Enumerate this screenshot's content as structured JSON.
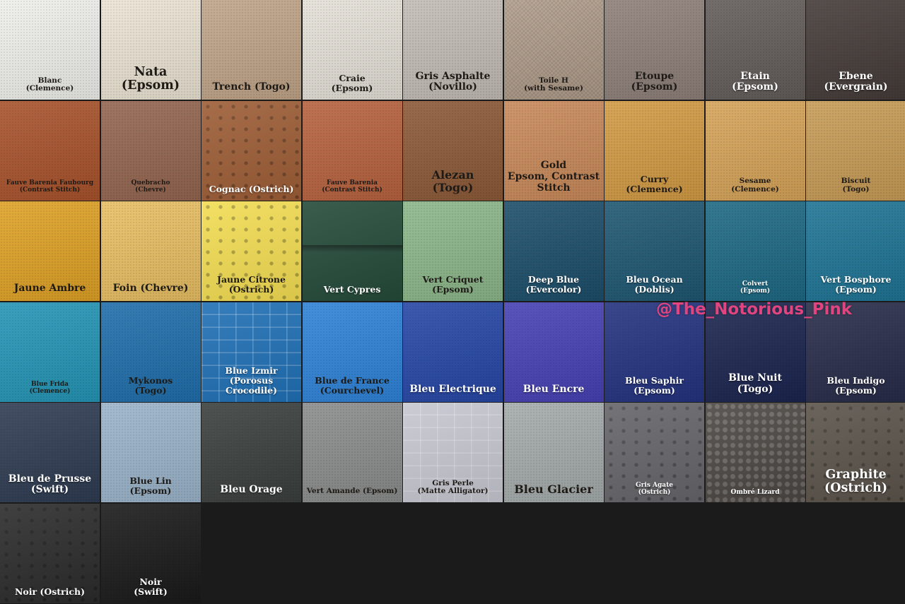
{
  "watermark": "@The_Notorious_Pink",
  "swatches": [
    {
      "name": "Blanc\n(Clemence)",
      "bg": "#efefeb",
      "light": false,
      "size": "s",
      "texture": "grain"
    },
    {
      "name": "Nata\n(Epsom)",
      "bg": "#ebe4d4",
      "light": false,
      "size": "xxl",
      "texture": "grain"
    },
    {
      "name": "Trench (Togo)",
      "bg": "#c0a487",
      "light": false,
      "size": "l",
      "texture": "grain"
    },
    {
      "name": "Craie\n(Epsom)",
      "bg": "#e5e1d8",
      "light": false,
      "size": "m",
      "texture": "grain"
    },
    {
      "name": "Gris Asphalte\n(Novillo)",
      "bg": "#c3bcb6",
      "light": false,
      "size": "l",
      "texture": "grain"
    },
    {
      "name": "Toile H\n(with Sesame)",
      "bg": "#b29f8c",
      "light": false,
      "size": "s",
      "texture": "canvas"
    },
    {
      "name": "Etoupe\n(Epsom)",
      "bg": "#8e8079",
      "light": false,
      "size": "l",
      "texture": "grain"
    },
    {
      "name": "Etain\n(Epsom)",
      "bg": "#635d5a",
      "light": true,
      "size": "l",
      "texture": "grain"
    },
    {
      "name": "Ebene\n(Evergrain)",
      "bg": "#453c39",
      "light": true,
      "size": "l",
      "texture": "grain"
    },
    {
      "name": "Fauve Barenia Faubourg\n(Contrast Stitch)",
      "bg": "#a9532c",
      "light": false,
      "size": "xs",
      "texture": "grain"
    },
    {
      "name": "Quebracho\n(Chevre)",
      "bg": "#94664f",
      "light": false,
      "size": "xs",
      "texture": "grain"
    },
    {
      "name": "Cognac (Ostrich)",
      "bg": "#9d5d36",
      "light": true,
      "size": "m",
      "texture": "ostrich"
    },
    {
      "name": "Fauve Barenia\n(Contrast Stitch)",
      "bg": "#b8633f",
      "light": false,
      "size": "xs",
      "texture": "grain"
    },
    {
      "name": "Alezan\n(Togo)",
      "bg": "#8d5a38",
      "light": false,
      "size": "xl",
      "texture": "grain"
    },
    {
      "name": "Gold\nEpsom, Contrast Stitch",
      "bg": "#c98a5a",
      "light": false,
      "size": "l",
      "texture": "grain"
    },
    {
      "name": "Curry\n(Clemence)",
      "bg": "#d39b44",
      "light": false,
      "size": "m",
      "texture": "grain"
    },
    {
      "name": "Sesame\n(Clemence)",
      "bg": "#d6a459",
      "light": false,
      "size": "s",
      "texture": "grain"
    },
    {
      "name": "Biscuit\n(Togo)",
      "bg": "#c79c57",
      "light": false,
      "size": "s",
      "texture": "grain"
    },
    {
      "name": "Jaune Ambre",
      "bg": "#dfa226",
      "light": false,
      "size": "l",
      "texture": "grain"
    },
    {
      "name": "Foin (Chevre)",
      "bg": "#e8bf63",
      "light": false,
      "size": "l",
      "texture": "grain"
    },
    {
      "name": "Jaune Citrone\n(Ostrich)",
      "bg": "#f1dc52",
      "light": false,
      "size": "m",
      "texture": "ostrich"
    },
    {
      "name": "Vert Cypres",
      "bg": "#244a39",
      "light": true,
      "size": "m",
      "texture": "flap"
    },
    {
      "name": "Vert Criquet\n(Epsom)",
      "bg": "#8cb78a",
      "light": false,
      "size": "m",
      "texture": "grain"
    },
    {
      "name": "Deep Blue\n(Evercolor)",
      "bg": "#1d4f6b",
      "light": true,
      "size": "m",
      "texture": "grain"
    },
    {
      "name": "Bleu Ocean (Doblis)",
      "bg": "#1f5873",
      "light": true,
      "size": "m",
      "texture": "grain"
    },
    {
      "name": "Colvert\n(Epsom)",
      "bg": "#1d6a84",
      "light": true,
      "size": "xs",
      "texture": "grain"
    },
    {
      "name": "Vert Bosphore\n(Epsom)",
      "bg": "#1f7596",
      "light": true,
      "size": "m",
      "texture": "grain"
    },
    {
      "name": "Blue Frida\n(Clemence)",
      "bg": "#2596b6",
      "light": false,
      "size": "xs",
      "texture": "grain"
    },
    {
      "name": "Mykonos\n(Togo)",
      "bg": "#1f6fac",
      "light": false,
      "size": "m",
      "texture": "grain"
    },
    {
      "name": "Blue Izmir\n(Porosus Crocodile)",
      "bg": "#1f6fb4",
      "light": true,
      "size": "m",
      "texture": "croc"
    },
    {
      "name": "Blue de France\n(Courchevel)",
      "bg": "#2f83d8",
      "light": false,
      "size": "m",
      "texture": "grain"
    },
    {
      "name": "Bleu Electrique",
      "bg": "#2747a8",
      "light": true,
      "size": "l",
      "texture": "grain"
    },
    {
      "name": "Bleu Encre",
      "bg": "#4742b5",
      "light": true,
      "size": "l",
      "texture": "grain"
    },
    {
      "name": "Bleu Saphir\n(Epsom)",
      "bg": "#243380",
      "light": true,
      "size": "m",
      "texture": "grain"
    },
    {
      "name": "Blue Nuit\n(Togo)",
      "bg": "#1b2550",
      "light": true,
      "size": "l",
      "texture": "grain"
    },
    {
      "name": "Bleu Indigo\n(Epsom)",
      "bg": "#282c49",
      "light": true,
      "size": "m",
      "texture": "grain"
    },
    {
      "name": "Bleu de Prusse\n(Swift)",
      "bg": "#2f3c52",
      "light": true,
      "size": "l",
      "texture": "grain"
    },
    {
      "name": "Blue Lin\n(Epsom)",
      "bg": "#9bb4ca",
      "light": false,
      "size": "m",
      "texture": "grain"
    },
    {
      "name": "Bleu Orage",
      "bg": "#3b403e",
      "light": true,
      "size": "l",
      "texture": "grain"
    },
    {
      "name": "Vert Amande (Epsom)",
      "bg": "#8b8c8c",
      "light": false,
      "size": "s",
      "texture": "grain"
    },
    {
      "name": "Gris Perle\n(Matte Alligator)",
      "bg": "#c5c6cf",
      "light": false,
      "size": "s",
      "texture": "croc"
    },
    {
      "name": "Bleu Glacier",
      "bg": "#a5abab",
      "light": false,
      "size": "xl",
      "texture": "grain"
    },
    {
      "name": "Gris Agate\n(Ostrich)",
      "bg": "#656468",
      "light": true,
      "size": "xs",
      "texture": "ostrich"
    },
    {
      "name": "Ombré Lizard",
      "bg": "#4b4642",
      "light": true,
      "size": "xs",
      "texture": "lizard"
    },
    {
      "name": "Graphite\n(Ostrich)",
      "bg": "#5a534a",
      "light": true,
      "size": "xxl",
      "texture": "ostrich"
    },
    {
      "name": "Noir (Ostrich)",
      "bg": "#2b2b2b",
      "light": true,
      "size": "m",
      "texture": "ostrich"
    },
    {
      "name": "Noir\n(Swift)",
      "bg": "#1a1a1a",
      "light": true,
      "size": "m",
      "texture": "grain"
    }
  ]
}
